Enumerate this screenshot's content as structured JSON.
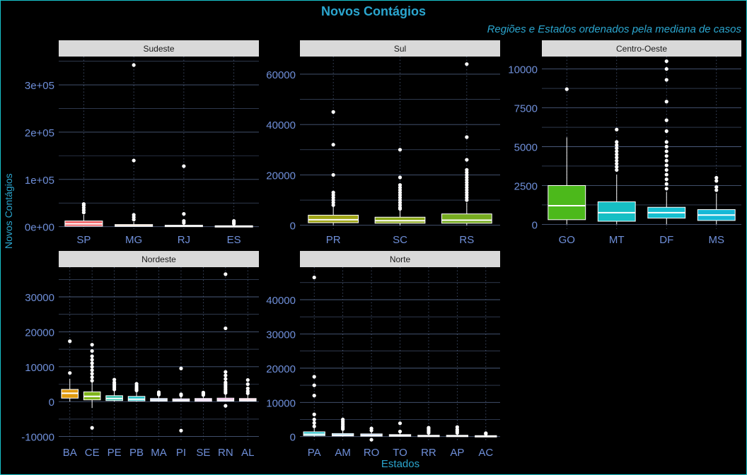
{
  "title": "Novos Contágios",
  "subtitle": "Regiões e Estados ordenados pela mediana de casos",
  "ylabel": "Novos Contágios",
  "xlabel": "Estados",
  "colors": {
    "background": "#000000",
    "accent": "#2ba6cf",
    "grid": "#4a5a7a",
    "tick_text": "#6f8fd9",
    "strip_bg": "#d9d9d9",
    "box_stroke": "#ffffff"
  },
  "chart_data": [
    {
      "type": "box",
      "panel": "Sudeste",
      "ylim": [
        -5000,
        360000
      ],
      "yticks": [
        0,
        100000,
        200000,
        300000
      ],
      "ytick_labels": [
        "0e+00",
        "1e+05",
        "2e+05",
        "3e+05"
      ],
      "categories": [
        "SP",
        "MG",
        "RJ",
        "ES"
      ],
      "boxes": [
        {
          "name": "SP",
          "q1": 1000,
          "median": 6000,
          "q3": 12000,
          "low": 0,
          "high": 25000,
          "color": "#f0595e",
          "outliers": [
            30000,
            35000,
            40000,
            45000,
            48000
          ]
        },
        {
          "name": "MG",
          "q1": 500,
          "median": 2000,
          "q3": 4500,
          "low": 0,
          "high": 10000,
          "color": "#d97b38",
          "outliers": [
            15000,
            20000,
            25000,
            140000,
            342000
          ]
        },
        {
          "name": "RJ",
          "q1": 300,
          "median": 1500,
          "q3": 3000,
          "low": 0,
          "high": 6000,
          "color": "#bf8a1e",
          "outliers": [
            8000,
            12000,
            27000,
            128000
          ]
        },
        {
          "name": "ES",
          "q1": 200,
          "median": 1000,
          "q3": 2000,
          "low": 0,
          "high": 4000,
          "color": "#a89a18",
          "outliers": [
            6000,
            9000,
            12000
          ]
        }
      ]
    },
    {
      "type": "box",
      "panel": "Sul",
      "ylim": [
        -1500,
        67000
      ],
      "yticks": [
        0,
        20000,
        40000,
        60000
      ],
      "ytick_labels": [
        "0",
        "20000",
        "40000",
        "60000"
      ],
      "categories": [
        "PR",
        "SC",
        "RS"
      ],
      "boxes": [
        {
          "name": "PR",
          "q1": 1000,
          "median": 2200,
          "q3": 4000,
          "low": 0,
          "high": 7500,
          "color": "#a0a517",
          "outliers": [
            8000,
            9000,
            10000,
            11000,
            12000,
            13000,
            20000,
            32000,
            45000
          ]
        },
        {
          "name": "SC",
          "q1": 800,
          "median": 1800,
          "q3": 3200,
          "low": 0,
          "high": 6000,
          "color": "#8ba81a",
          "outliers": [
            6500,
            7000,
            8000,
            9000,
            10000,
            11000,
            12000,
            13000,
            14000,
            15000,
            16000,
            19000,
            30000
          ]
        },
        {
          "name": "RS",
          "q1": 800,
          "median": 2000,
          "q3": 4500,
          "low": 0,
          "high": 9000,
          "color": "#76ab1f",
          "outliers": [
            10000,
            11000,
            12000,
            13000,
            14000,
            15000,
            16000,
            17000,
            18000,
            19000,
            20000,
            21000,
            22000,
            26000,
            35000,
            64000
          ]
        }
      ]
    },
    {
      "type": "box",
      "panel": "Centro-Oeste",
      "ylim": [
        -300,
        10800
      ],
      "yticks": [
        0,
        2500,
        5000,
        7500,
        10000
      ],
      "ytick_labels": [
        "0",
        "2500",
        "5000",
        "7500",
        "10000"
      ],
      "categories": [
        "GO",
        "MT",
        "DF",
        "MS"
      ],
      "boxes": [
        {
          "name": "GO",
          "q1": 300,
          "median": 1200,
          "q3": 2500,
          "low": 0,
          "high": 5600,
          "color": "#4cb91b",
          "outliers": [
            8700
          ]
        },
        {
          "name": "MT",
          "q1": 200,
          "median": 750,
          "q3": 1450,
          "low": 0,
          "high": 3200,
          "color": "#16bfc4",
          "outliers": [
            3500,
            3700,
            3900,
            4100,
            4300,
            4500,
            4700,
            4900,
            5100,
            5300,
            6100
          ]
        },
        {
          "name": "DF",
          "q1": 400,
          "median": 750,
          "q3": 1100,
          "low": 0,
          "high": 2100,
          "color": "#16bfd0",
          "outliers": [
            2300,
            2600,
            2900,
            3200,
            3500,
            3800,
            4100,
            4400,
            4700,
            5000,
            5300,
            6000,
            6700,
            7900,
            9300,
            10000,
            10500
          ]
        },
        {
          "name": "MS",
          "q1": 250,
          "median": 600,
          "q3": 950,
          "low": 0,
          "high": 2000,
          "color": "#16b8d6",
          "outliers": [
            2200,
            2400,
            2800,
            3000
          ]
        }
      ]
    },
    {
      "type": "box",
      "panel": "Nordeste",
      "ylim": [
        -11500,
        38500
      ],
      "yticks": [
        -10000,
        0,
        10000,
        20000,
        30000
      ],
      "ytick_labels": [
        "-10000",
        "0",
        "10000",
        "20000",
        "30000"
      ],
      "categories": [
        "BA",
        "CE",
        "PE",
        "PB",
        "MA",
        "PI",
        "SE",
        "RN",
        "AL"
      ],
      "boxes": [
        {
          "name": "BA",
          "q1": 1000,
          "median": 2400,
          "q3": 3500,
          "low": 0,
          "high": 6500,
          "color": "#e09a0e",
          "outliers": [
            8200,
            17300
          ]
        },
        {
          "name": "CE",
          "q1": 500,
          "median": 1500,
          "q3": 2800,
          "low": -1800,
          "high": 5500,
          "color": "#7fb41a",
          "outliers": [
            -7500,
            6000,
            7000,
            8000,
            9000,
            10000,
            11000,
            12000,
            13000,
            14500,
            16300
          ]
        },
        {
          "name": "PE",
          "q1": 300,
          "median": 900,
          "q3": 1700,
          "low": 0,
          "high": 3000,
          "color": "#2abfa8",
          "outliers": [
            3500,
            4000,
            4500,
            5000,
            5500,
            6300
          ]
        },
        {
          "name": "PB",
          "q1": 200,
          "median": 700,
          "q3": 1500,
          "low": 0,
          "high": 2800,
          "color": "#19c0c7",
          "outliers": [
            3200,
            3600,
            4000,
            4500,
            5100
          ]
        },
        {
          "name": "MA",
          "q1": 150,
          "median": 500,
          "q3": 900,
          "low": 0,
          "high": 1800,
          "color": "#7aa3e0",
          "outliers": [
            2000,
            2300,
            2700
          ]
        },
        {
          "name": "PI",
          "q1": 100,
          "median": 400,
          "q3": 800,
          "low": 0,
          "high": 1500,
          "color": "#a98fe0",
          "outliers": [
            -8300,
            1800,
            2100,
            9500
          ]
        },
        {
          "name": "SE",
          "q1": 100,
          "median": 500,
          "q3": 900,
          "low": 0,
          "high": 1500,
          "color": "#c98ad6",
          "outliers": [
            1900,
            2300,
            2600
          ]
        },
        {
          "name": "RN",
          "q1": 150,
          "median": 500,
          "q3": 1000,
          "low": 0,
          "high": 2000,
          "color": "#e58ad0",
          "outliers": [
            -1200,
            2500,
            3000,
            3500,
            4000,
            4500,
            5000,
            5500,
            6500,
            7500,
            8500,
            21000,
            36500
          ]
        },
        {
          "name": "AL",
          "q1": 150,
          "median": 500,
          "q3": 900,
          "low": 0,
          "high": 2000,
          "color": "#ef8fb0",
          "outliers": [
            2400,
            3000,
            3800,
            5000,
            6200
          ]
        }
      ]
    },
    {
      "type": "box",
      "panel": "Norte",
      "ylim": [
        -1500,
        49500
      ],
      "yticks": [
        0,
        10000,
        20000,
        30000,
        40000
      ],
      "ytick_labels": [
        "0",
        "10000",
        "20000",
        "30000",
        "40000"
      ],
      "categories": [
        "PA",
        "AM",
        "RO",
        "TO",
        "RR",
        "AP",
        "AC"
      ],
      "boxes": [
        {
          "name": "PA",
          "q1": 300,
          "median": 700,
          "q3": 1400,
          "low": 0,
          "high": 2500,
          "color": "#19bfc9",
          "outliers": [
            3000,
            4000,
            5000,
            6500,
            12000,
            15000,
            17500,
            46500
          ]
        },
        {
          "name": "AM",
          "q1": 200,
          "median": 500,
          "q3": 900,
          "low": 0,
          "high": 1800,
          "color": "#3aa6e8",
          "outliers": [
            2200,
            2600,
            3000,
            3500,
            4000,
            4500,
            5000
          ]
        },
        {
          "name": "RO",
          "q1": 150,
          "median": 400,
          "q3": 800,
          "low": 0,
          "high": 1500,
          "color": "#6aa0ea",
          "outliers": [
            -900,
            1800,
            2400
          ]
        },
        {
          "name": "TO",
          "q1": 100,
          "median": 300,
          "q3": 600,
          "low": 0,
          "high": 1100,
          "color": "#8f8fe8",
          "outliers": [
            1500,
            3900
          ]
        },
        {
          "name": "RR",
          "q1": 50,
          "median": 200,
          "q3": 400,
          "low": 0,
          "high": 800,
          "color": "#b48be2",
          "outliers": [
            1100,
            1500,
            1900,
            2300,
            2600
          ]
        },
        {
          "name": "AP",
          "q1": 50,
          "median": 200,
          "q3": 400,
          "low": 0,
          "high": 800,
          "color": "#cf88dc",
          "outliers": [
            1100,
            1600,
            2100,
            2800
          ]
        },
        {
          "name": "AC",
          "q1": 50,
          "median": 150,
          "q3": 300,
          "low": 0,
          "high": 600,
          "color": "#e688cf",
          "outliers": [
            800,
            1000
          ]
        }
      ]
    }
  ]
}
